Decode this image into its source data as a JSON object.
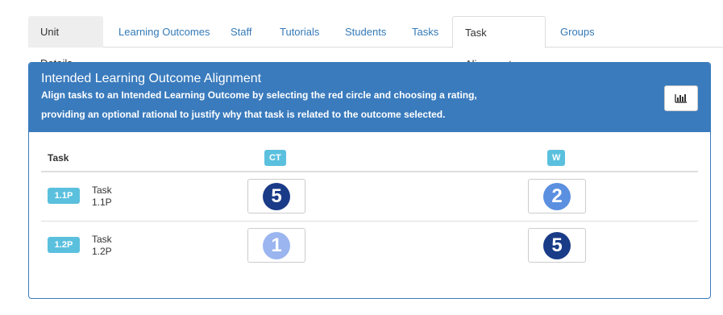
{
  "tabs": [
    {
      "label": "Unit Details"
    },
    {
      "label": "Learning Outcomes"
    },
    {
      "label": "Staff"
    },
    {
      "label": "Tutorials"
    },
    {
      "label": "Students"
    },
    {
      "label": "Tasks"
    },
    {
      "label": "Task Alignment"
    },
    {
      "label": "Groups"
    }
  ],
  "active_tab": "Task Alignment",
  "panel": {
    "title": "Intended Learning Outcome Alignment",
    "subtitle_line1": "Align tasks to an Intended Learning Outcome by selecting the red circle and choosing a rating,",
    "subtitle_line2": "providing an optional rational to justify why that task is related to the outcome selected.",
    "chart_button_icon": "bar-chart-icon"
  },
  "table": {
    "task_header": "Task",
    "outcomes": [
      {
        "label": "CT"
      },
      {
        "label": "W"
      }
    ],
    "rows": [
      {
        "badge": "1.1P",
        "name_line1": "Task",
        "name_line2": "1.1P",
        "ratings": [
          {
            "value": "5",
            "color": "#1a3b87"
          },
          {
            "value": "2",
            "color": "#5b8fe0"
          }
        ]
      },
      {
        "badge": "1.2P",
        "name_line1": "Task",
        "name_line2": "1.2P",
        "ratings": [
          {
            "value": "1",
            "color": "#9ab5ef"
          },
          {
            "value": "5",
            "color": "#1a3b87"
          }
        ]
      }
    ]
  },
  "colors": {
    "panel_header": "#3a7bbd",
    "badge": "#5bc0de",
    "link": "#337ab7"
  }
}
